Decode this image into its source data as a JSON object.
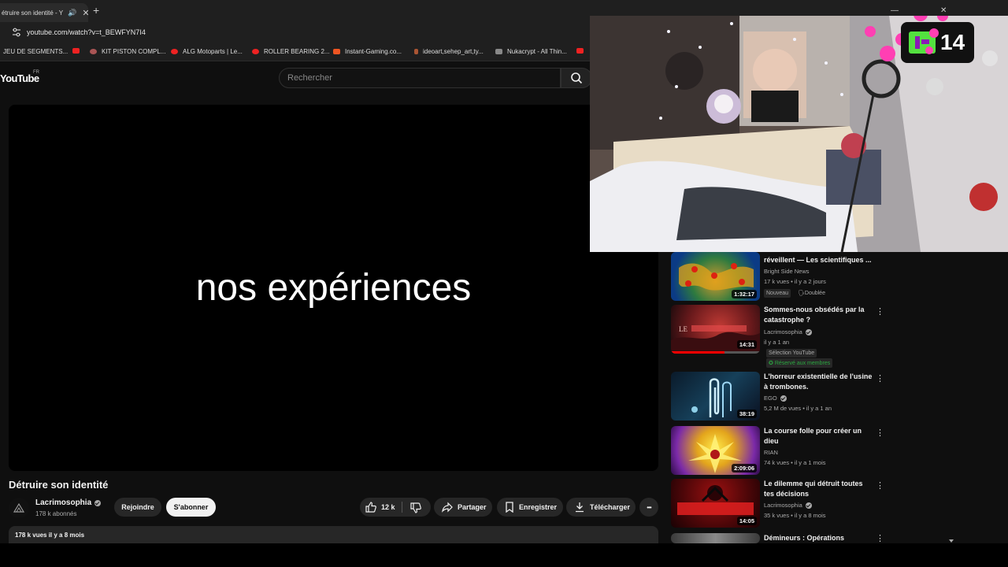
{
  "browser": {
    "tab_title": "étruire son identité - Y",
    "url": "youtube.com/watch?v=t_BEWFYN7I4",
    "bookmarks": [
      {
        "label": "JEU DE SEGMENTS...",
        "color": "#1f1f1f"
      },
      {
        "label": "KIT PISTON COMPL...",
        "color": "#cc2222"
      },
      {
        "label": "ALG Motoparts | Le...",
        "color": "#cc2222"
      },
      {
        "label": "ROLLER BEARING 2...",
        "color": "#cc2222"
      },
      {
        "label": "Instant-Gaming.co...",
        "color": "#ee5522"
      },
      {
        "label": "ideoart,sehep_art,ty...",
        "color": "#aa5533"
      },
      {
        "label": "Nukacrypt - All Thin...",
        "color": "#888888"
      }
    ]
  },
  "youtube": {
    "logo": "YouTube",
    "region": "FR",
    "search_placeholder": "Rechercher"
  },
  "player": {
    "caption": "nos expériences"
  },
  "video": {
    "title": "Détruire son identité",
    "channel": "Lacrimosophia",
    "subscribers": "178 k abonnés",
    "join_label": "Rejoindre",
    "subscribe_label": "S'abonner",
    "likes": "12 k",
    "share_label": "Partager",
    "save_label": "Enregistrer",
    "download_label": "Télécharger",
    "more_label": "•••",
    "views_date": "178 k vues  il y a 8 mois"
  },
  "recommendations": [
    {
      "title": "réveillent — Les scientifiques ...",
      "channel": "Bright Side News",
      "meta": "17 k vues • il y a 2 jours",
      "duration": "1:32:17",
      "badge1": "Nouveau",
      "badge2": "Doublée"
    },
    {
      "title": "Sommes-nous obsédés par la catastrophe ?",
      "channel": "Lacrimosophia",
      "meta": "il y a 1 an",
      "duration": "14:31",
      "badge1": "Sélection YouTube",
      "badge2": "Réservé aux membres"
    },
    {
      "title": "L'horreur existentielle de l'usine à trombones.",
      "channel": "EGO",
      "meta": "5,2 M de vues • il y a 1 an",
      "duration": "38:19"
    },
    {
      "title": "La course folle pour créer un dieu",
      "channel": "RIAN",
      "meta": "74 k vues • il y a 1 mois",
      "duration": "2:09:06"
    },
    {
      "title": "Le dilemme qui détruit toutes tes décisions",
      "channel": "Lacrimosophia",
      "meta": "35 k vues • il y a 8 mois",
      "duration": "14:05"
    },
    {
      "title": "Démineurs : Opérations",
      "channel": "",
      "meta": "",
      "duration": ""
    }
  ],
  "overlay": {
    "counter": "14"
  }
}
